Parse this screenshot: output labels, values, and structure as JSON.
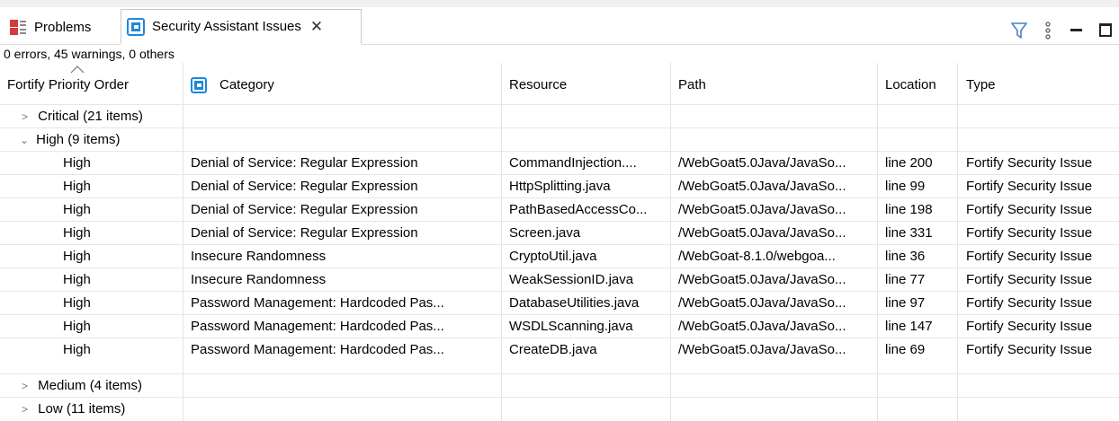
{
  "tabs": [
    {
      "label": "Problems",
      "icon": "problems-icon"
    },
    {
      "label": "Security Assistant Issues",
      "icon": "fortify-icon",
      "close": "✕"
    }
  ],
  "toolbar": {
    "filter_icon": "filter-icon",
    "menu_icon": "view-menu-icon",
    "minimize_icon": "minimize-icon",
    "maximize_icon": "maximize-icon"
  },
  "status": "0 errors, 45 warnings, 0 others",
  "columns": [
    "Fortify Priority Order",
    "Category",
    "Resource",
    "Path",
    "Location",
    "Type"
  ],
  "groups": {
    "critical": "Critical (21 items)",
    "high": "High (9 items)",
    "medium": "Medium (4 items)",
    "low": "Low (11 items)"
  },
  "rows": [
    {
      "priority": "High",
      "category": "Denial of Service: Regular Expression",
      "resource": "CommandInjection....",
      "path": "/WebGoat5.0Java/JavaSo...",
      "location": "line 200",
      "type": "Fortify Security Issue"
    },
    {
      "priority": "High",
      "category": "Denial of Service: Regular Expression",
      "resource": "HttpSplitting.java",
      "path": "/WebGoat5.0Java/JavaSo...",
      "location": "line 99",
      "type": "Fortify Security Issue"
    },
    {
      "priority": "High",
      "category": "Denial of Service: Regular Expression",
      "resource": "PathBasedAccessCo...",
      "path": "/WebGoat5.0Java/JavaSo...",
      "location": "line 198",
      "type": "Fortify Security Issue"
    },
    {
      "priority": "High",
      "category": "Denial of Service: Regular Expression",
      "resource": "Screen.java",
      "path": "/WebGoat5.0Java/JavaSo...",
      "location": "line 331",
      "type": "Fortify Security Issue"
    },
    {
      "priority": "High",
      "category": "Insecure Randomness",
      "resource": "CryptoUtil.java",
      "path": "/WebGoat-8.1.0/webgoa...",
      "location": "line 36",
      "type": "Fortify Security Issue"
    },
    {
      "priority": "High",
      "category": "Insecure Randomness",
      "resource": "WeakSessionID.java",
      "path": "/WebGoat5.0Java/JavaSo...",
      "location": "line 77",
      "type": "Fortify Security Issue"
    },
    {
      "priority": "High",
      "category": "Password Management: Hardcoded Pas...",
      "resource": "DatabaseUtilities.java",
      "path": "/WebGoat5.0Java/JavaSo...",
      "location": "line 97",
      "type": "Fortify Security Issue"
    },
    {
      "priority": "High",
      "category": "Password Management: Hardcoded Pas...",
      "resource": "WSDLScanning.java",
      "path": "/WebGoat5.0Java/JavaSo...",
      "location": "line 147",
      "type": "Fortify Security Issue"
    },
    {
      "priority": "High",
      "category": "Password Management: Hardcoded Pas...",
      "resource": "CreateDB.java",
      "path": "/WebGoat5.0Java/JavaSo...",
      "location": "line 69",
      "type": "Fortify Security Issue"
    }
  ]
}
